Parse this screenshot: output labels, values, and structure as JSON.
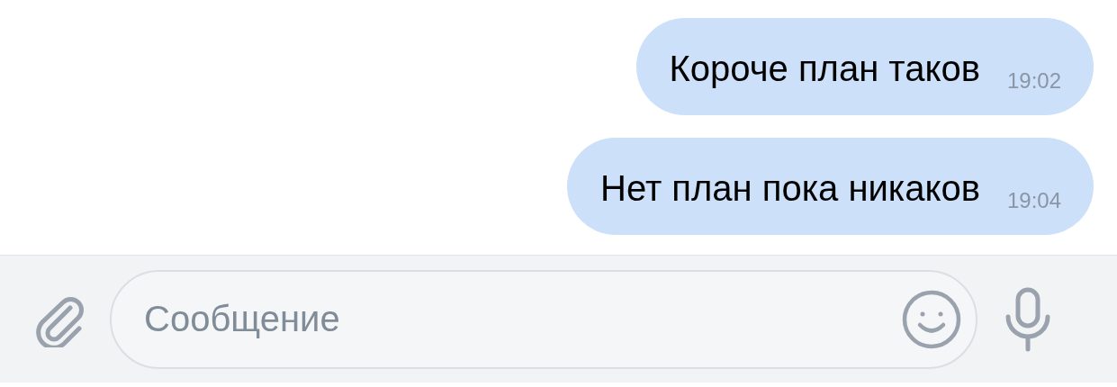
{
  "messages": [
    {
      "text": "Короче план таков",
      "time": "19:02"
    },
    {
      "text": "Нет план пока никаков",
      "time": "19:04"
    }
  ],
  "composer": {
    "placeholder": "Сообщение"
  }
}
